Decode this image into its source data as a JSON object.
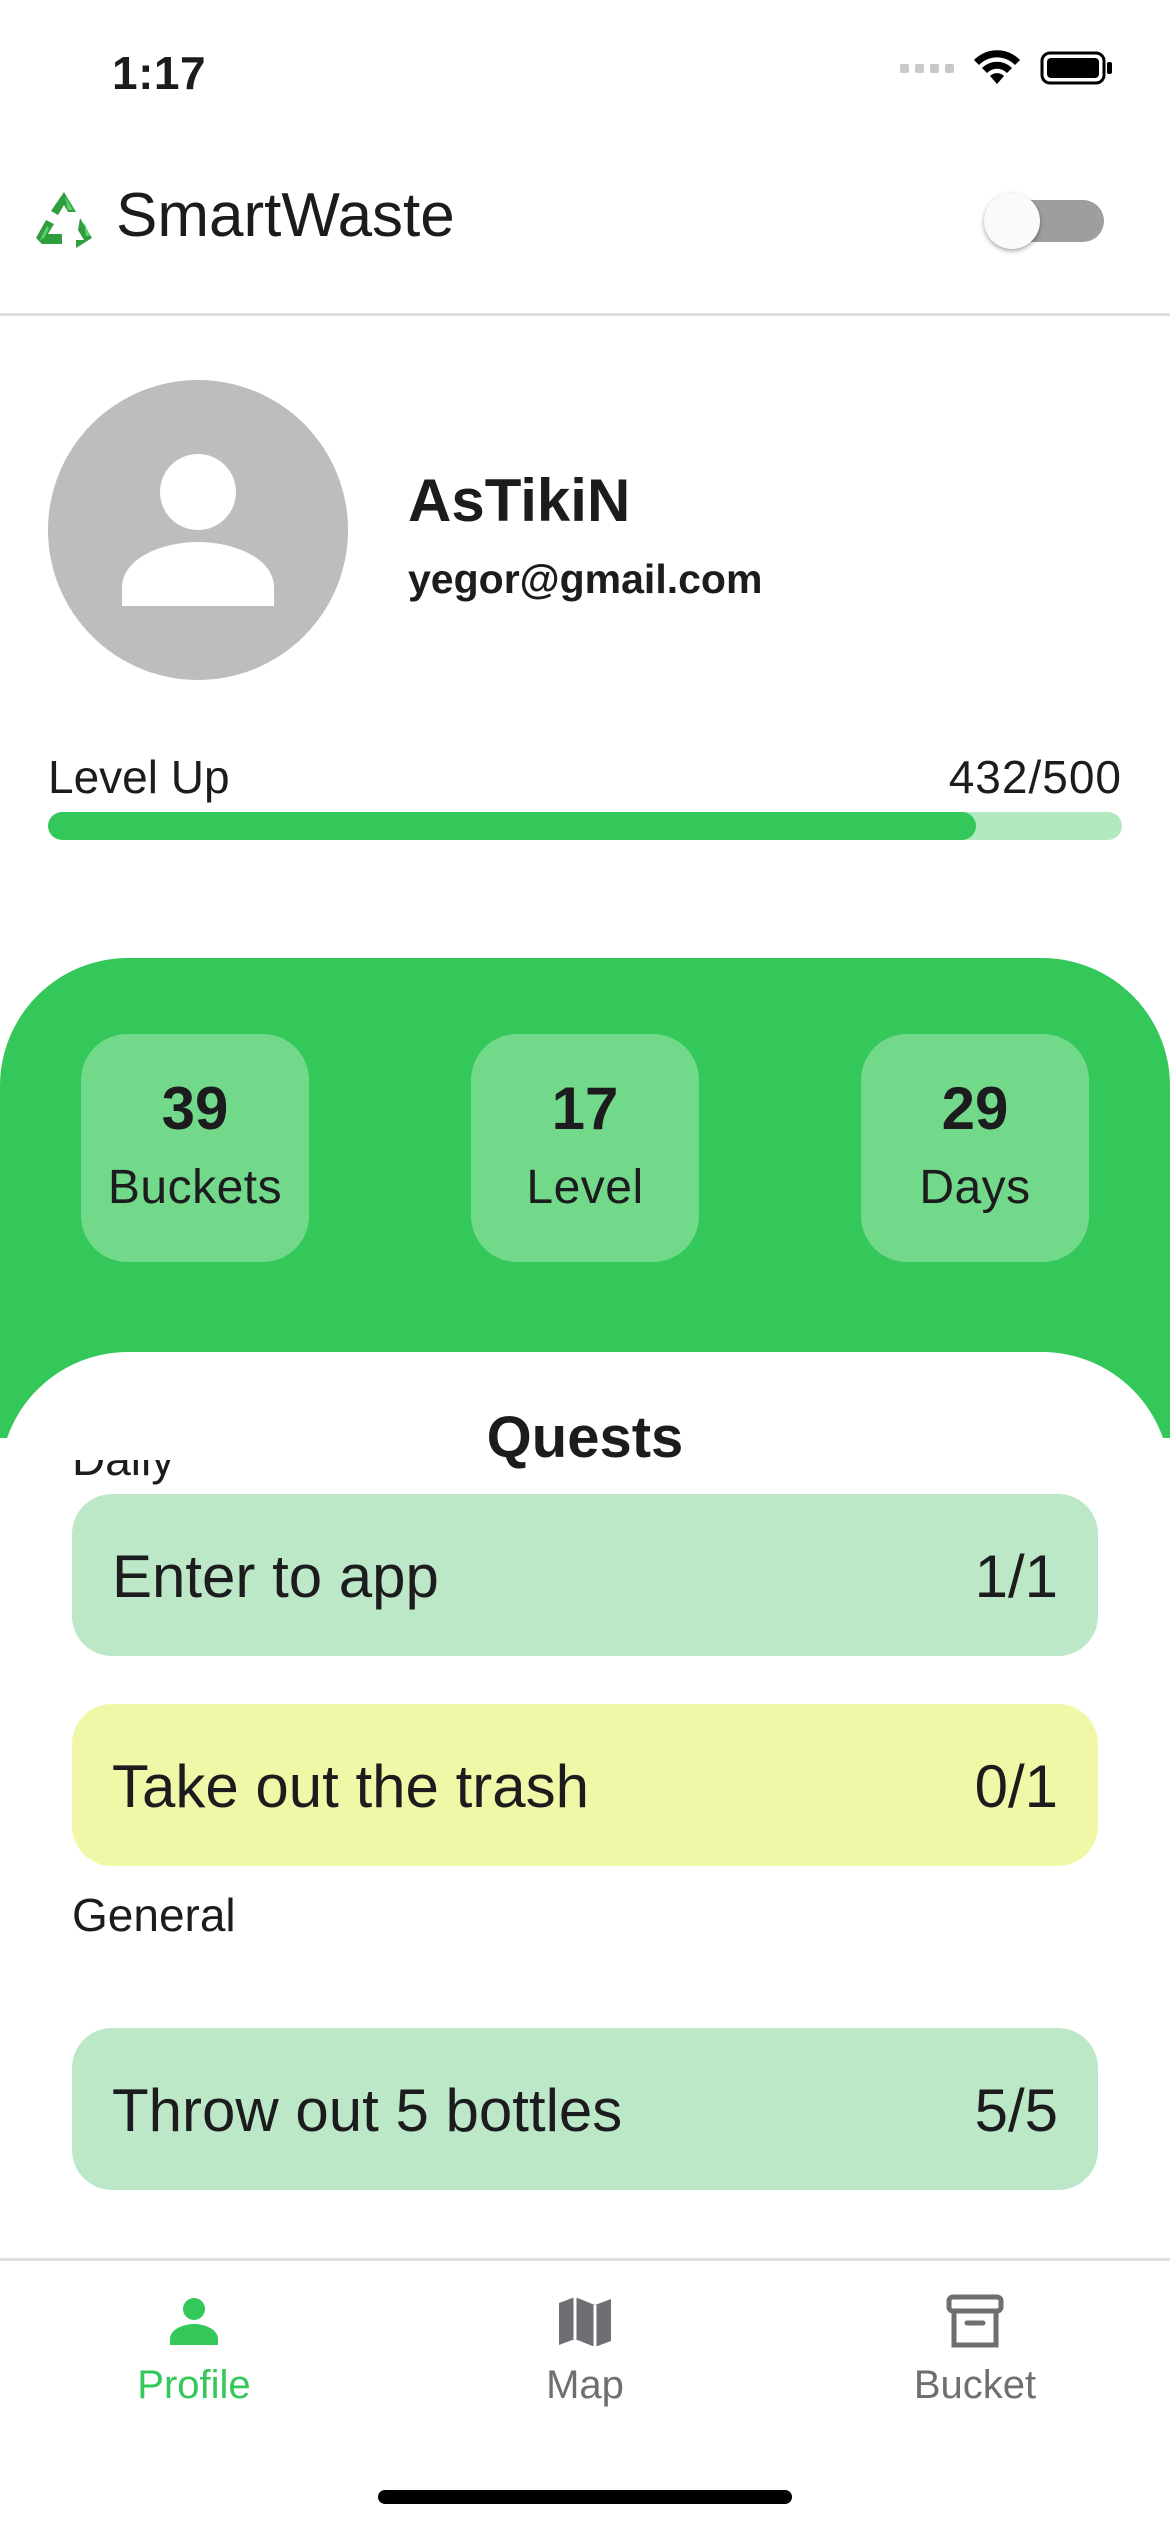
{
  "status_bar": {
    "time": "1:17"
  },
  "header": {
    "app_title": "SmartWaste",
    "theme_toggle_on": false
  },
  "profile": {
    "username": "AsTikiN",
    "email": "yegor@gmail.com"
  },
  "level_up": {
    "label": "Level Up",
    "current": 432,
    "target": 500,
    "count_text": "432/500"
  },
  "stats": [
    {
      "value": "39",
      "label": "Buckets"
    },
    {
      "value": "17",
      "label": "Level"
    },
    {
      "value": "29",
      "label": "Days"
    }
  ],
  "quests": {
    "title": "Quests",
    "daily_label": "Daily",
    "daily": [
      {
        "name": "Enter to app",
        "progress": "1/1",
        "status": "done"
      },
      {
        "name": "Take out the trash",
        "progress": "0/1",
        "status": "pending"
      }
    ],
    "general_label": "General",
    "general": [
      {
        "name": "Throw out 5 bottles",
        "progress": "5/5",
        "status": "done"
      }
    ]
  },
  "bottom_nav": {
    "items": [
      {
        "label": "Profile",
        "icon": "person-icon",
        "active": true
      },
      {
        "label": "Map",
        "icon": "map-icon",
        "active": false
      },
      {
        "label": "Bucket",
        "icon": "archive-box-icon",
        "active": false
      }
    ]
  },
  "colors": {
    "accent": "#34c759",
    "stat_card": "#72d98a",
    "quest_done": "#bce8c8",
    "quest_pending": "#f0f8a8",
    "progress_track": "#b3e9c0"
  }
}
